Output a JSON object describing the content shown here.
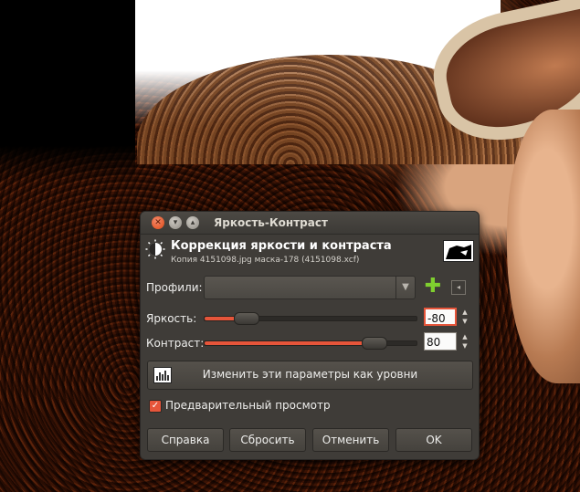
{
  "dialog": {
    "title": "Яркость-Контраст",
    "header_title": "Коррекция яркости и контраста",
    "header_subtitle": "Копия 4151098.jpg маска-178 (4151098.xcf)",
    "presets_label": "Профили:",
    "brightness_label": "Яркость:",
    "brightness_value": "-80",
    "brightness_level_percent": 20,
    "contrast_label": "Контраст:",
    "contrast_value": "80",
    "contrast_level_percent": 80,
    "edit_as_levels_label": "Изменить эти параметры как уровни",
    "preview_label": "Предварительный просмотр",
    "preview_checked": true,
    "buttons": {
      "help": "Справка",
      "reset": "Сбросить",
      "cancel": "Отменить",
      "ok": "OK"
    },
    "accent_color": "#e6553a",
    "icons": [
      "close-icon",
      "minimize-icon",
      "maximize-icon",
      "brightness-contrast-icon",
      "add-icon",
      "menu-icon",
      "levels-icon"
    ]
  }
}
